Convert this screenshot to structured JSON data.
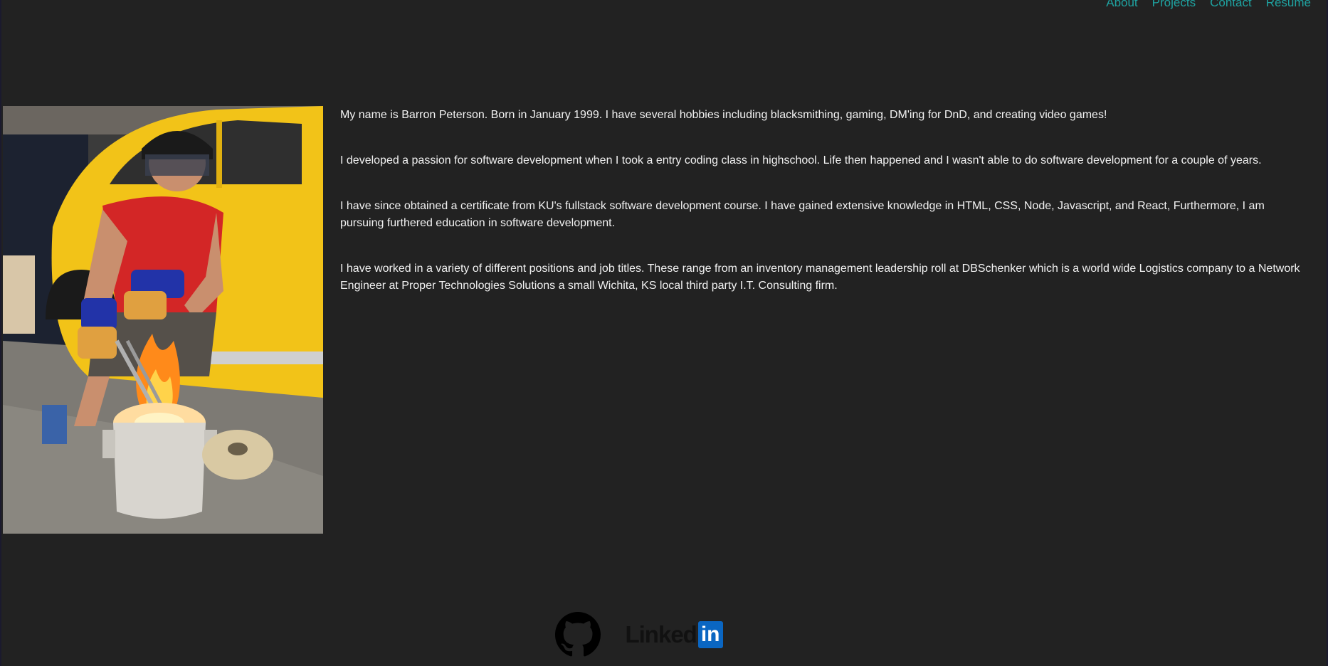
{
  "nav": {
    "items": [
      {
        "label": "About"
      },
      {
        "label": "Projects"
      },
      {
        "label": "Contact"
      },
      {
        "label": "Resume"
      }
    ]
  },
  "about": {
    "paragraphs": [
      "My name is Barron Peterson. Born in January 1999. I have several hobbies including blacksmithing, gaming, DM'ing for DnD, and creating video games!",
      "I developed a passion for software development when I took a entry coding class in highschool. Life then happened and I wasn't able to do software development for a couple of years.",
      "I have since obtained a certificate from KU's fullstack software development course. I have gained extensive knowledge in HTML, CSS, Node, Javascript, and React, Furthermore, I am pursuing furthered education in software development.",
      "I have worked in a variety of different positions and job titles. These range from an inventory management leadership roll at DBSchenker which is a world wide Logistics company to a Network Engineer at Proper Technologies Solutions a small Wichita, KS local third party I.T. Consulting firm."
    ]
  },
  "footer": {
    "github_icon": "github-icon",
    "linkedin_word": "Linked",
    "linkedin_box": "in"
  },
  "colors": {
    "background": "#222222",
    "nav_link": "#1fa3a1",
    "text": "#f2f2f2",
    "linkedin_blue": "#0a66c2"
  }
}
